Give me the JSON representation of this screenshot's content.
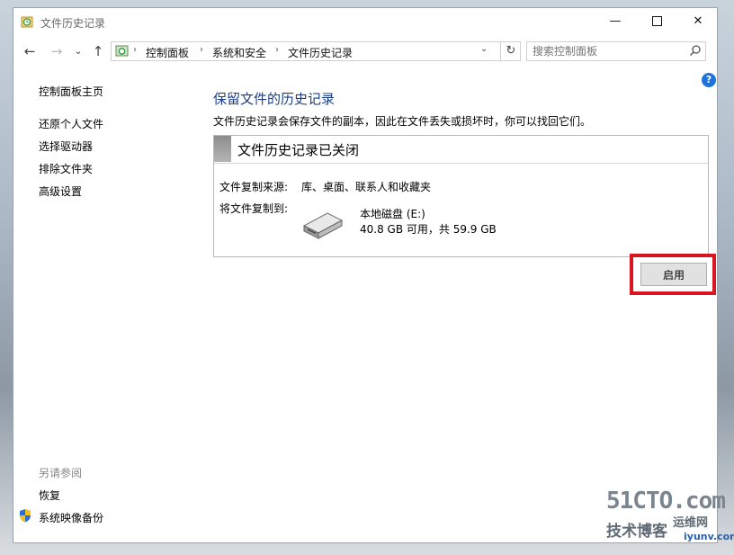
{
  "window": {
    "title": "文件历史记录",
    "minimize_glyph": "—",
    "close_glyph": "✕"
  },
  "nav": {
    "back_glyph": "←",
    "forward_glyph": "→",
    "recent_glyph": "⌄",
    "up_glyph": "↑"
  },
  "address": {
    "breadcrumbs": [
      "控制面板",
      "系统和安全",
      "文件历史记录"
    ],
    "separator": "›",
    "dropdown_glyph": "⌄",
    "refresh_glyph": "↻"
  },
  "search": {
    "placeholder": "搜索控制面板"
  },
  "help": {
    "glyph": "?"
  },
  "sidebar": {
    "home": "控制面板主页",
    "items": [
      {
        "label": "还原个人文件"
      },
      {
        "label": "选择驱动器"
      },
      {
        "label": "排除文件夹"
      },
      {
        "label": "高级设置"
      }
    ],
    "see_also_heading": "另请参阅",
    "see_also": [
      {
        "label": "恢复"
      },
      {
        "label": "系统映像备份"
      }
    ]
  },
  "main": {
    "title": "保留文件的历史记录",
    "description": "文件历史记录会保存文件的副本，因此在文件丢失或损坏时，你可以找回它们。",
    "status_title": "文件历史记录已关闭",
    "copy_from_label": "文件复制来源:",
    "copy_from_value": "库、桌面、联系人和收藏夹",
    "copy_to_label": "将文件复制到:",
    "drive_name": "本地磁盘 (E:)",
    "drive_space": "40.8 GB 可用，共 59.9 GB",
    "enable_button": "启用"
  },
  "watermark": {
    "top": "51CTO.com",
    "bottom": "技术博客",
    "side": "运维网",
    "url": "iyunv.com"
  },
  "colors": {
    "title_blue": "#1a3e8c",
    "highlight_red": "#d9161f",
    "help_blue": "#1e73d8"
  }
}
